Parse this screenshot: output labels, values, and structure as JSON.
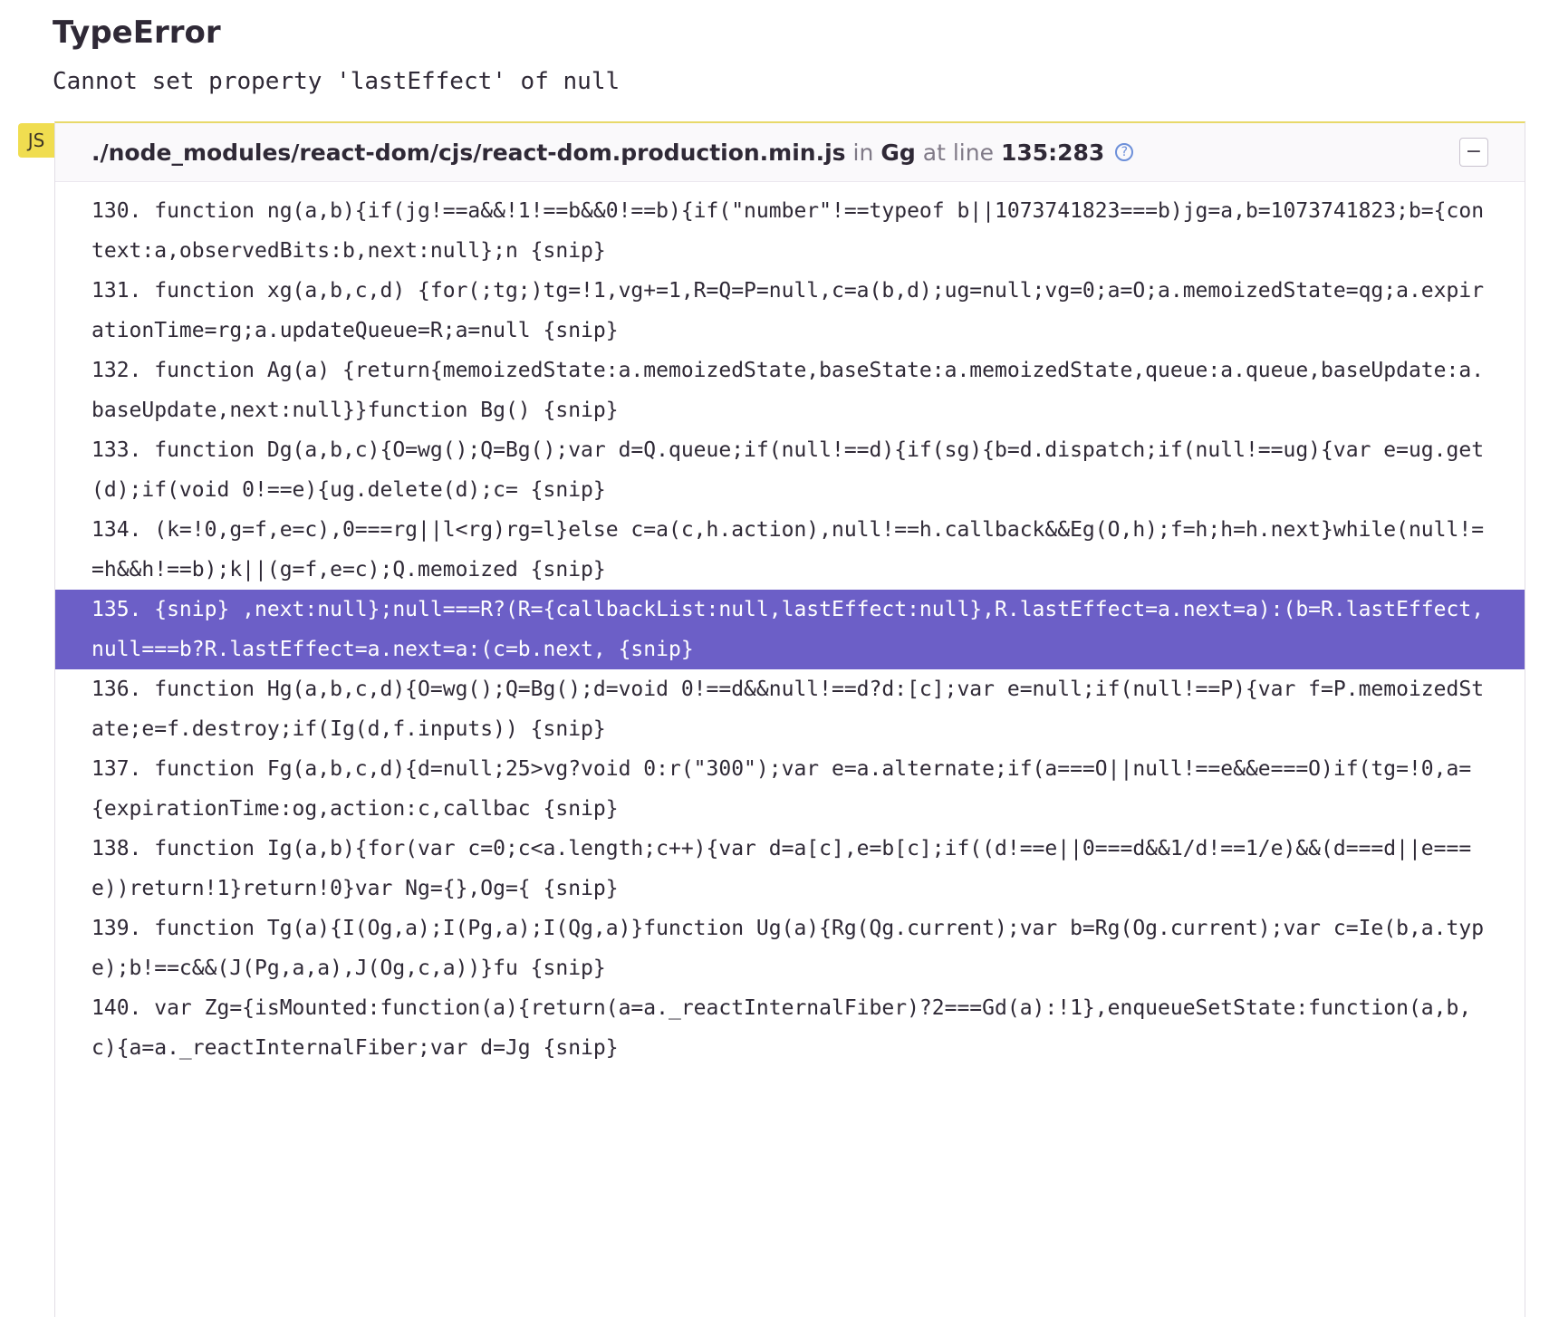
{
  "error": {
    "type": "TypeError",
    "message": "Cannot set property 'lastEffect' of null"
  },
  "frame": {
    "platform": "JS",
    "filename": "./node_modules/react-dom/cjs/react-dom.production.min.js",
    "in_label": "in",
    "function": "Gg",
    "at_line_label": "at line",
    "lineno": "135:283",
    "help_icon": "question-circle-icon",
    "collapse_label": "−"
  },
  "code_lines": [
    {
      "text": "130. function ng(a,b){if(jg!==a&&!1!==b&&0!==b){if(\"number\"!==typeof b||1073741823===b)jg=a,b=1073741823;b={context:a,observedBits:b,next:null};n {snip}",
      "active": false
    },
    {
      "text": "131. function xg(a,b,c,d) {for(;tg;)tg=!1,vg+=1,R=Q=P=null,c=a(b,d);ug=null;vg=0;a=O;a.memoizedState=qg;a.expirationTime=rg;a.updateQueue=R;a=null {snip}",
      "active": false
    },
    {
      "text": "132. function Ag(a) {return{memoizedState:a.memoizedState,baseState:a.memoizedState,queue:a.queue,baseUpdate:a.baseUpdate,next:null}}function Bg() {snip}",
      "active": false
    },
    {
      "text": "133. function Dg(a,b,c){O=wg();Q=Bg();var d=Q.queue;if(null!==d){if(sg){b=d.dispatch;if(null!==ug){var e=ug.get(d);if(void 0!==e){ug.delete(d);c= {snip}",
      "active": false
    },
    {
      "text": "134. (k=!0,g=f,e=c),0===rg||l<rg)rg=l}else c=a(c,h.action),null!==h.callback&&Eg(O,h);f=h;h=h.next}while(null!==h&&h!==b);k||(g=f,e=c);Q.memoized {snip}",
      "active": false
    },
    {
      "text": "135. {snip} ,next:null};null===R?(R={callbackList:null,lastEffect:null},R.lastEffect=a.next=a):(b=R.lastEffect,null===b?R.lastEffect=a.next=a:(c=b.next, {snip}",
      "active": true
    },
    {
      "text": "136. function Hg(a,b,c,d){O=wg();Q=Bg();d=void 0!==d&&null!==d?d:[c];var e=null;if(null!==P){var f=P.memoizedState;e=f.destroy;if(Ig(d,f.inputs)) {snip}",
      "active": false
    },
    {
      "text": "137. function Fg(a,b,c,d){d=null;25>vg?void 0:r(\"300\");var e=a.alternate;if(a===O||null!==e&&e===O)if(tg=!0,a={expirationTime:og,action:c,callbac {snip}",
      "active": false
    },
    {
      "text": "138. function Ig(a,b){for(var c=0;c<a.length;c++){var d=a[c],e=b[c];if((d!==e||0===d&&1/d!==1/e)&&(d===d||e===e))return!1}return!0}var Ng={},Og={ {snip}",
      "active": false
    },
    {
      "text": "139. function Tg(a){I(Og,a);I(Pg,a);I(Qg,a)}function Ug(a){Rg(Qg.current);var b=Rg(Og.current);var c=Ie(b,a.type);b!==c&&(J(Pg,a,a),J(Og,c,a))}fu {snip}",
      "active": false
    },
    {
      "text": "140. var Zg={isMounted:function(a){return(a=a._reactInternalFiber)?2===Gd(a):!1},enqueueSetState:function(a,b,c){a=a._reactInternalFiber;var d=Jg {snip}",
      "active": false
    }
  ]
}
